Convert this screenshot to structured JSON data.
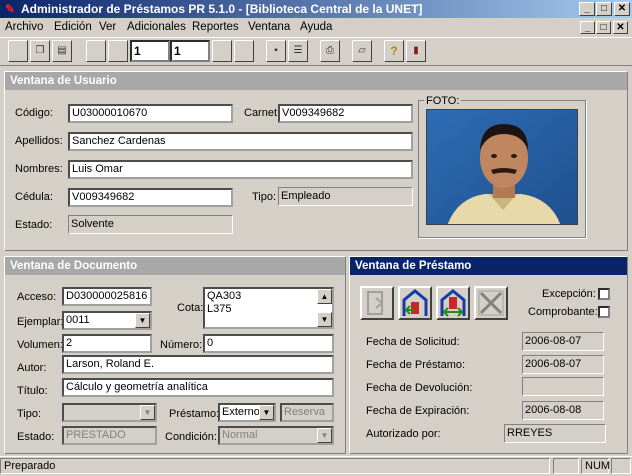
{
  "window": {
    "title": "Administrador de Préstamos PR 5.1.0 - [Biblioteca Central de la UNET]",
    "minimize_glyph": "_",
    "restore_glyph": "□",
    "close_glyph": "✕"
  },
  "menu": {
    "items": [
      "Archivo",
      "Edición",
      "Ver",
      "Adicionales",
      "Reportes",
      "Ventana",
      "Ayuda"
    ],
    "doc_min_glyph": "_",
    "doc_restore_glyph": "□",
    "doc_close_glyph": "✕"
  },
  "toolbar": {
    "page_current": "1",
    "page_total": "1",
    "help_glyph": "?"
  },
  "usuario": {
    "panel_title": "Ventana de Usuario",
    "codigo_label": "Código:",
    "codigo": "U03000010670",
    "carnet_label": "Carnet:",
    "carnet": "V009349682",
    "apellidos_label": "Apellidos:",
    "apellidos": "Sanchez Cardenas",
    "nombres_label": "Nombres:",
    "nombres": "Luis Omar",
    "cedula_label": "Cédula:",
    "cedula": "V009349682",
    "tipo_label": "Tipo:",
    "tipo": "Empleado",
    "estado_label": "Estado:",
    "estado": "Solvente",
    "foto_label": "FOTO:"
  },
  "documento": {
    "panel_title": "Ventana de Documento",
    "acceso_label": "Acceso:",
    "acceso": "D030000025816",
    "cota_label": "Cota:",
    "cota_line1": "QA303",
    "cota_line2": "L375",
    "ejemplar_label": "Ejemplar:",
    "ejemplar": "0011",
    "volumen_label": "Volumen:",
    "volumen": "2",
    "numero_label": "Número:",
    "numero": "0",
    "autor_label": "Autor:",
    "autor": "Larson, Roland E.",
    "titulo_label": "Título:",
    "titulo": "Cálculo y geometría analítica",
    "tipo_label": "Tipo:",
    "tipo": "",
    "prestamo_label": "Préstamo:",
    "prestamo": "Externo",
    "reserva_label": "Reserva",
    "estado_label": "Estado:",
    "estado": "PRESTADO",
    "condicion_label": "Condición:",
    "condicion": "Normal"
  },
  "prestamo": {
    "panel_title": "Ventana de Préstamo",
    "excepcion_label": "Excepción:",
    "comprobante_label": "Comprobante:",
    "fecha_solicitud_label": "Fecha de Solicitud:",
    "fecha_solicitud": "2006-08-07",
    "fecha_prestamo_label": "Fecha de Préstamo:",
    "fecha_prestamo": "2006-08-07",
    "fecha_devolucion_label": "Fecha de Devolución:",
    "fecha_devolucion": "",
    "fecha_expiracion_label": "Fecha de Expiración:",
    "fecha_expiracion": "2006-08-08",
    "autorizado_label": "Autorizado por:",
    "autorizado": "RREYES"
  },
  "statusbar": {
    "text": "Preparado",
    "num": "NUM"
  },
  "colors": {
    "titlebar": "#0a246a",
    "face": "#d4d0c8",
    "active_panel": "#0a246a",
    "inactive_panel": "#a8a8a8"
  }
}
